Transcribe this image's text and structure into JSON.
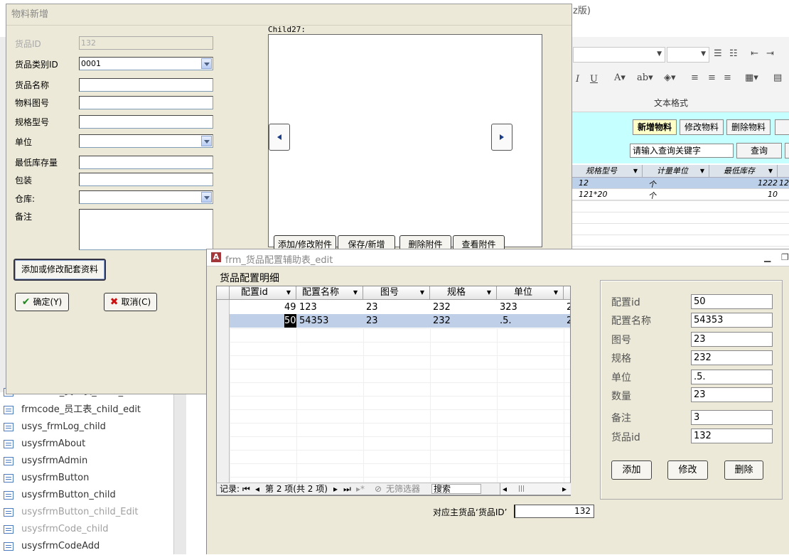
{
  "background_window": {
    "title_fragment": "z版)",
    "ribbon_group_caption": "文本格式",
    "toolbar": {
      "new_label": "新增物料",
      "edit_label": "修改物料",
      "delete_label": "删除物料",
      "search_placeholder": "请输入查询关键字",
      "query_label": "查询"
    },
    "grid": {
      "columns": [
        "规格型号",
        "计量单位",
        "最低库存"
      ],
      "rows": [
        {
          "spec": "12",
          "unit": "个",
          "min_stock": "1222",
          "extra": "12"
        },
        {
          "spec": "121*20",
          "unit": "个",
          "min_stock": "10",
          "extra": ""
        }
      ]
    }
  },
  "nav_pane": {
    "items": [
      {
        "label": "frmcode_员工表_child_add",
        "dim": false
      },
      {
        "label": "frmcode_员工表_child_edit",
        "dim": false
      },
      {
        "label": "usys_frmLog_child",
        "dim": false
      },
      {
        "label": "usysfrmAbout",
        "dim": false
      },
      {
        "label": "usysfrmAdmin",
        "dim": false
      },
      {
        "label": "usysfrmButton",
        "dim": false
      },
      {
        "label": "usysfrmButton_child",
        "dim": false
      },
      {
        "label": "usysfrmButton_child_Edit",
        "dim": true
      },
      {
        "label": "usysfrmCode_child",
        "dim": true
      },
      {
        "label": "usysfrmCodeAdd",
        "dim": false
      }
    ]
  },
  "material_dialog": {
    "title": "物料新增",
    "fields": {
      "goods_id": {
        "label": "货品ID",
        "value": "132"
      },
      "category_id": {
        "label": "货品类别ID",
        "value": "0001"
      },
      "name": {
        "label": "货品名称",
        "value": ""
      },
      "drawing_no": {
        "label": "物料图号",
        "value": ""
      },
      "spec": {
        "label": "规格型号",
        "value": ""
      },
      "unit": {
        "label": "单位",
        "value": ""
      },
      "min_stock": {
        "label": "最低库存量",
        "value": ""
      },
      "package": {
        "label": "包装",
        "value": ""
      },
      "warehouse": {
        "label": "仓库:",
        "value": ""
      },
      "remark": {
        "label": "备注",
        "value": ""
      }
    },
    "attachment_label": "Child27:",
    "attachment_buttons": {
      "add_modify": "添加/修改附件",
      "save_new": "保存/新增",
      "delete": "删除附件",
      "view": "查看附件"
    },
    "config_button": "添加或修改配套资料",
    "ok_button": "确定(Y)",
    "cancel_button": "取消(C)"
  },
  "config_dialog": {
    "title": "frm_货品配置辅助表_edit",
    "subtitle": "货品配置明细",
    "columns": [
      "配置id",
      "配置名称",
      "图号",
      "规格",
      "单位",
      "2"
    ],
    "rows": [
      {
        "id": "49",
        "name": "123",
        "drawing": "23",
        "spec": "232",
        "unit": "323",
        "extra": "2"
      },
      {
        "id": "50",
        "name": "54353",
        "drawing": "23",
        "spec": "232",
        "unit": ".5.",
        "extra": "2"
      }
    ],
    "record_nav": {
      "label": "记录:",
      "position": "第 2 项(共 2 项)",
      "filter": "无筛选器",
      "search": "搜索"
    },
    "detail": {
      "config_id": {
        "label": "配置id",
        "value": "50"
      },
      "config_name": {
        "label": "配置名称",
        "value": "54353"
      },
      "drawing_no": {
        "label": "图号",
        "value": "23"
      },
      "spec": {
        "label": "规格",
        "value": "232"
      },
      "unit": {
        "label": "单位",
        "value": ".5."
      },
      "quantity": {
        "label": "数量",
        "value": "23"
      },
      "remark": {
        "label": "备注",
        "value": "3"
      },
      "goods_id": {
        "label": "货品id",
        "value": "132"
      }
    },
    "buttons": {
      "add": "添加",
      "edit": "修改",
      "delete": "删除"
    },
    "footer": {
      "label": "对应主货品‘货品ID’",
      "value": "132"
    }
  }
}
